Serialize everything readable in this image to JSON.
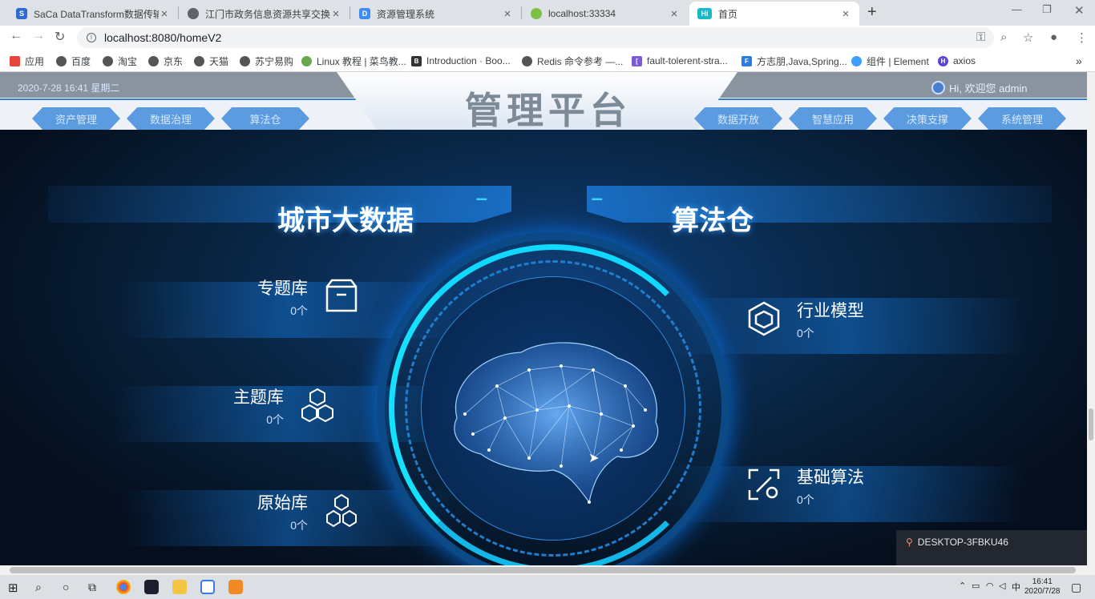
{
  "browser": {
    "tabs": [
      {
        "title": "SaCa DataTransform数据传输平",
        "color": "#2e6ad1",
        "glyph": "S"
      },
      {
        "title": "江门市政务信息资源共享交换平",
        "color": "#5f6368",
        "glyph": "◎"
      },
      {
        "title": "资源管理系统",
        "color": "#3f8cf0",
        "glyph": "D"
      },
      {
        "title": "localhost:33334",
        "color": "#7cc144",
        "glyph": "●"
      },
      {
        "title": "首页",
        "color": "#19b8c9",
        "glyph": "Hi"
      }
    ],
    "new_tab": "+",
    "url": "localhost:8080/homeV2",
    "bookmarks": [
      {
        "label": "应用",
        "color": "#e8453c"
      },
      {
        "label": "百度",
        "color": "#555"
      },
      {
        "label": "淘宝",
        "color": "#555"
      },
      {
        "label": "京东",
        "color": "#555"
      },
      {
        "label": "天猫",
        "color": "#555"
      },
      {
        "label": "苏宁易购",
        "color": "#555"
      },
      {
        "label": "Linux 教程 | 菜鸟教...",
        "color": "#6aa84f"
      },
      {
        "label": "Introduction · Boo...",
        "color": "#333"
      },
      {
        "label": "Redis 命令参考 —...",
        "color": "#555"
      },
      {
        "label": "fault-tolerent-stra...",
        "color": "#7b5cd6"
      },
      {
        "label": "方志朋,Java,Spring...",
        "color": "#2c7be5"
      },
      {
        "label": "组件 | Element",
        "color": "#409eff"
      },
      {
        "label": "axios",
        "color": "#5a45d6"
      }
    ],
    "more": "»"
  },
  "header": {
    "datetime": "2020-7-28 16:41 星期二",
    "title": "管理平台",
    "welcome": "Hi, 欢迎您 admin",
    "nav_left": [
      "资产管理",
      "数据治理",
      "算法仓"
    ],
    "nav_right": [
      "数据开放",
      "智慧应用",
      "决策支撑",
      "系统管理"
    ]
  },
  "left_panel": {
    "title": "城市大数据",
    "items": [
      {
        "name": "专题库",
        "count": "0个"
      },
      {
        "name": "主题库",
        "count": "0个"
      },
      {
        "name": "原始库",
        "count": "0个"
      }
    ]
  },
  "right_panel": {
    "title": "算法仓",
    "items": [
      {
        "name": "行业模型",
        "count": "0个"
      },
      {
        "name": "基础算法",
        "count": "0个"
      }
    ]
  },
  "overlay": {
    "host": "DESKTOP-3FBKU46"
  },
  "taskbar": {
    "time": "16:41",
    "date": "2020/7/28"
  }
}
